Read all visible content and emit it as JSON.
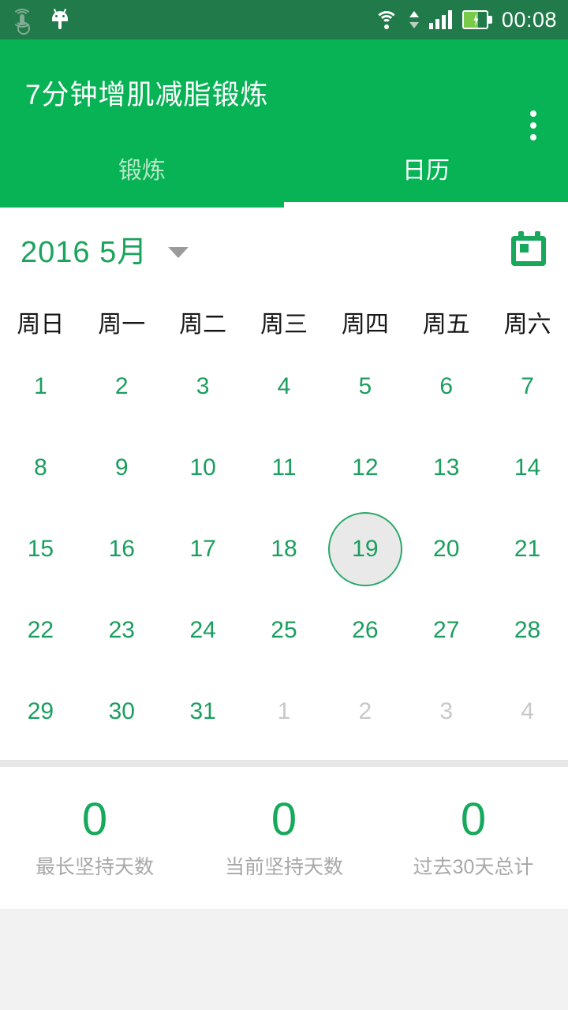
{
  "statusbar": {
    "time": "00:08",
    "icons": [
      "hotspot-icon",
      "android-icon",
      "wifi-icon",
      "data-arrows-icon",
      "signal-icon",
      "battery-charging-icon"
    ],
    "background_color": "#217a4a"
  },
  "appbar": {
    "title": "7分钟增肌减脂锻炼",
    "overflow_label": "⋮",
    "background_color": "#07b354",
    "tabs": [
      {
        "label": "锻炼",
        "active": false
      },
      {
        "label": "日历",
        "active": true
      }
    ]
  },
  "calendar": {
    "month_label": "2016 5月",
    "caret": "chevron-down-icon",
    "today_button": "calendar-icon",
    "accent_color": "#1aa35c",
    "weekdays": [
      "周日",
      "周一",
      "周二",
      "周三",
      "周四",
      "周五",
      "周六"
    ],
    "selected_day": "19",
    "weeks": [
      [
        {
          "d": "1",
          "muted": false
        },
        {
          "d": "2",
          "muted": false
        },
        {
          "d": "3",
          "muted": false
        },
        {
          "d": "4",
          "muted": false
        },
        {
          "d": "5",
          "muted": false
        },
        {
          "d": "6",
          "muted": false
        },
        {
          "d": "7",
          "muted": false
        }
      ],
      [
        {
          "d": "8",
          "muted": false
        },
        {
          "d": "9",
          "muted": false
        },
        {
          "d": "10",
          "muted": false
        },
        {
          "d": "11",
          "muted": false
        },
        {
          "d": "12",
          "muted": false
        },
        {
          "d": "13",
          "muted": false
        },
        {
          "d": "14",
          "muted": false
        }
      ],
      [
        {
          "d": "15",
          "muted": false
        },
        {
          "d": "16",
          "muted": false
        },
        {
          "d": "17",
          "muted": false
        },
        {
          "d": "18",
          "muted": false
        },
        {
          "d": "19",
          "muted": false
        },
        {
          "d": "20",
          "muted": false
        },
        {
          "d": "21",
          "muted": false
        }
      ],
      [
        {
          "d": "22",
          "muted": false
        },
        {
          "d": "23",
          "muted": false
        },
        {
          "d": "24",
          "muted": false
        },
        {
          "d": "25",
          "muted": false
        },
        {
          "d": "26",
          "muted": false
        },
        {
          "d": "27",
          "muted": false
        },
        {
          "d": "28",
          "muted": false
        }
      ],
      [
        {
          "d": "29",
          "muted": false
        },
        {
          "d": "30",
          "muted": false
        },
        {
          "d": "31",
          "muted": false
        },
        {
          "d": "1",
          "muted": true
        },
        {
          "d": "2",
          "muted": true
        },
        {
          "d": "3",
          "muted": true
        },
        {
          "d": "4",
          "muted": true
        }
      ]
    ]
  },
  "stats": [
    {
      "value": "0",
      "label": "最长坚持天数"
    },
    {
      "value": "0",
      "label": "当前坚持天数"
    },
    {
      "value": "0",
      "label": "过去30天总计"
    }
  ]
}
